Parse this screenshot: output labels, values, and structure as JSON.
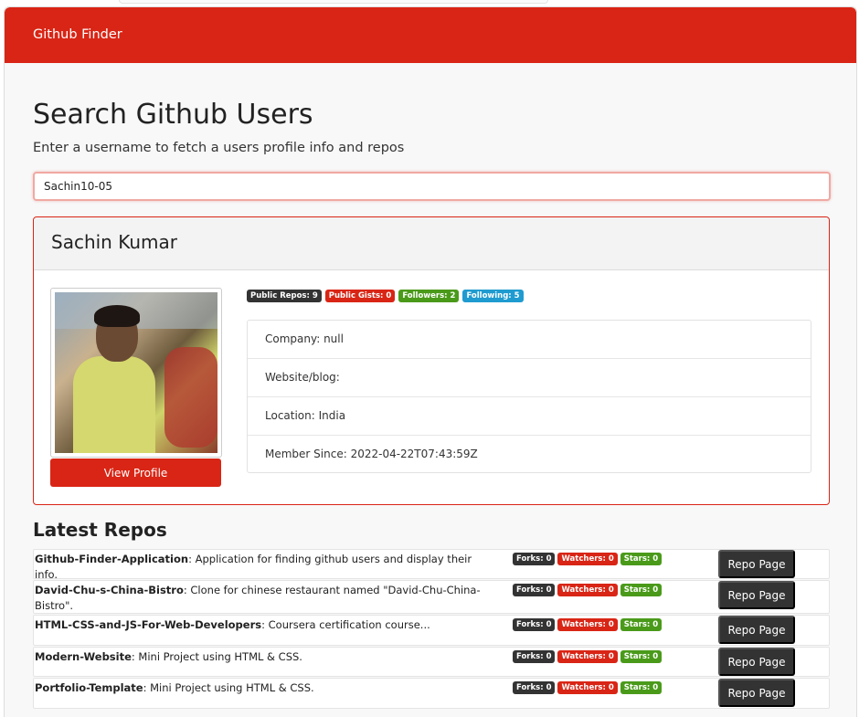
{
  "navbar": {
    "brand": "Github Finder"
  },
  "header": {
    "title": "Search Github Users",
    "subtitle": "Enter a username to fetch a users profile info and repos"
  },
  "search": {
    "value": "Sachin10-05"
  },
  "profile": {
    "name": "Sachin Kumar",
    "view_profile_label": "View Profile",
    "badges": {
      "public_repos": "Public Repos: 9",
      "public_gists": "Public Gists: 0",
      "followers": "Followers: 2",
      "following": "Following: 5"
    },
    "details": {
      "company": "Company: null",
      "website": "Website/blog:",
      "location": "Location: India",
      "member_since": "Member Since: 2022-04-22T07:43:59Z"
    }
  },
  "repos_section": {
    "title": "Latest Repos"
  },
  "repos": [
    {
      "name": "Github-Finder-Application",
      "description": ": Application for finding github users and display their info.",
      "forks": "Forks: 0",
      "watchers": "Watchers: 0",
      "stars": "Stars: 0",
      "button": "Repo Page"
    },
    {
      "name": "David-Chu-s-China-Bistro",
      "description": ": Clone for chinese restaurant named \"David-Chu-China-Bistro\".",
      "forks": "Forks: 0",
      "watchers": "Watchers: 0",
      "stars": "Stars: 0",
      "button": "Repo Page"
    },
    {
      "name": "HTML-CSS-and-JS-For-Web-Developers",
      "description": ": Coursera certification course...",
      "forks": "Forks: 0",
      "watchers": "Watchers: 0",
      "stars": "Stars: 0",
      "button": "Repo Page"
    },
    {
      "name": "Modern-Website",
      "description": ": Mini Project using HTML & CSS.",
      "forks": "Forks: 0",
      "watchers": "Watchers: 0",
      "stars": "Stars: 0",
      "button": "Repo Page"
    },
    {
      "name": "Portfolio-Template",
      "description": ": Mini Project using HTML & CSS.",
      "forks": "Forks: 0",
      "watchers": "Watchers: 0",
      "stars": "Stars: 0",
      "button": "Repo Page"
    }
  ],
  "colors": {
    "brand_red": "#d92515",
    "dark": "#333333",
    "green": "#4a9a1a",
    "blue": "#1f9bd0"
  }
}
